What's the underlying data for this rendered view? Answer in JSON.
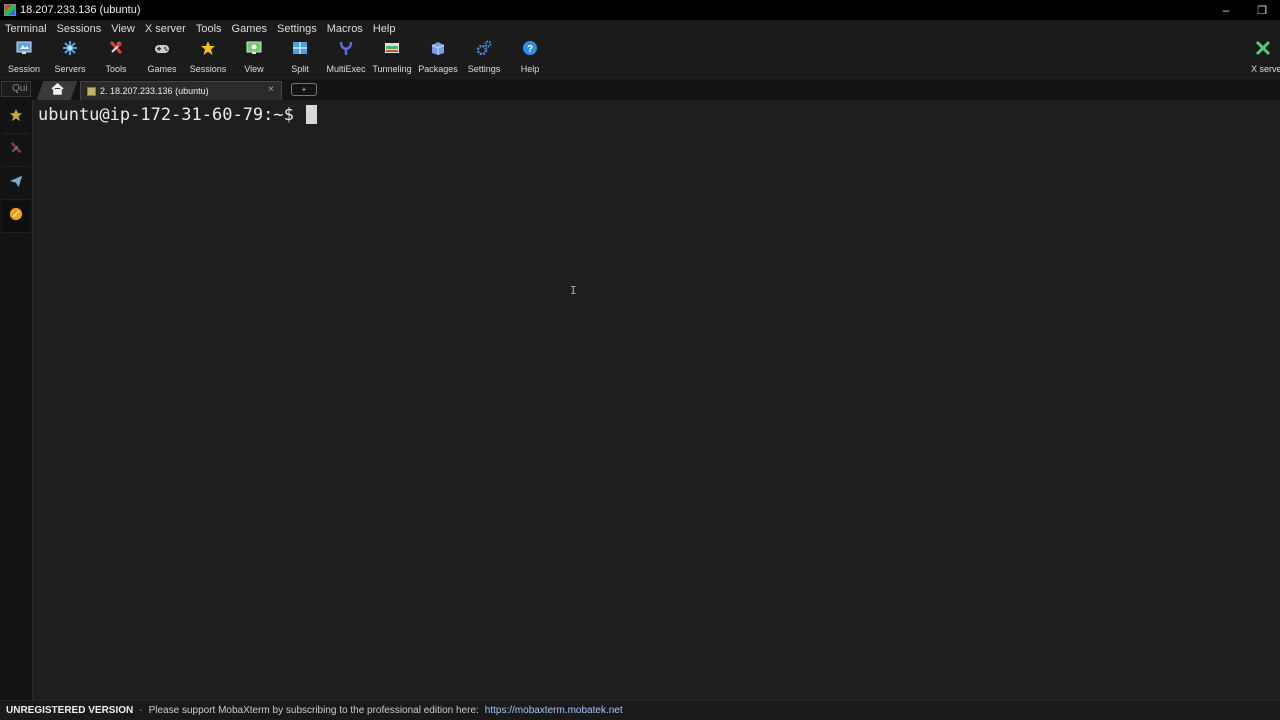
{
  "window": {
    "title": "18.207.233.136 (ubuntu)",
    "restore_glyph": "❐"
  },
  "menu": [
    "Terminal",
    "Sessions",
    "View",
    "X server",
    "Tools",
    "Games",
    "Settings",
    "Macros",
    "Help"
  ],
  "toolbar": [
    {
      "label": "Session",
      "icon": "session-monitor-icon",
      "color": "#5aa0e6"
    },
    {
      "label": "Servers",
      "icon": "servers-icon",
      "color": "#4aa3e8"
    },
    {
      "label": "Tools",
      "icon": "tools-icon",
      "color": "#e04040"
    },
    {
      "label": "Games",
      "icon": "gamepad-icon",
      "color": "#cccccc"
    },
    {
      "label": "Sessions",
      "icon": "star-icon",
      "color": "#f2c21a"
    },
    {
      "label": "View",
      "icon": "view-monitor-icon",
      "color": "#6ccc6c"
    },
    {
      "label": "Split",
      "icon": "split-icon",
      "color": "#4a9ee8"
    },
    {
      "label": "MultiExec",
      "icon": "multiexec-fork-icon",
      "color": "#5a6de0"
    },
    {
      "label": "Tunneling",
      "icon": "tunneling-icon",
      "color": "#3cbf5c"
    },
    {
      "label": "Packages",
      "icon": "packages-icon",
      "color": "#7b9ce8"
    },
    {
      "label": "Settings",
      "icon": "settings-gears-icon",
      "color": "#4a8ce0"
    },
    {
      "label": "Help",
      "icon": "help-question-icon",
      "color": "#2e8fe8"
    }
  ],
  "xserver": {
    "label": "X serve",
    "icon": "x-server-icon",
    "color": "#4fd070"
  },
  "quick_connect": {
    "placeholder": "Qui"
  },
  "tabs": {
    "session_label": "2. 18.207.233.136 (ubuntu)",
    "close_glyph": "×",
    "new_tab_glyph": "+"
  },
  "sidebar": [
    {
      "icon": "star-icon",
      "color": "#c8a838"
    },
    {
      "icon": "tools-icon",
      "color": "#8a3a3a"
    },
    {
      "icon": "send-plane-icon",
      "color": "#7fa8cc"
    },
    {
      "icon": "macro-orange-icon",
      "color": "#f0a020"
    }
  ],
  "terminal": {
    "prompt": "ubuntu@ip-172-31-60-79:~$ ",
    "mouse_ibeam": "I"
  },
  "status": {
    "unregistered": "UNREGISTERED VERSION",
    "separator": "-",
    "message": "Please support MobaXterm by subscribing to the professional edition here:",
    "link": "https://mobaxterm.mobatek.net"
  }
}
